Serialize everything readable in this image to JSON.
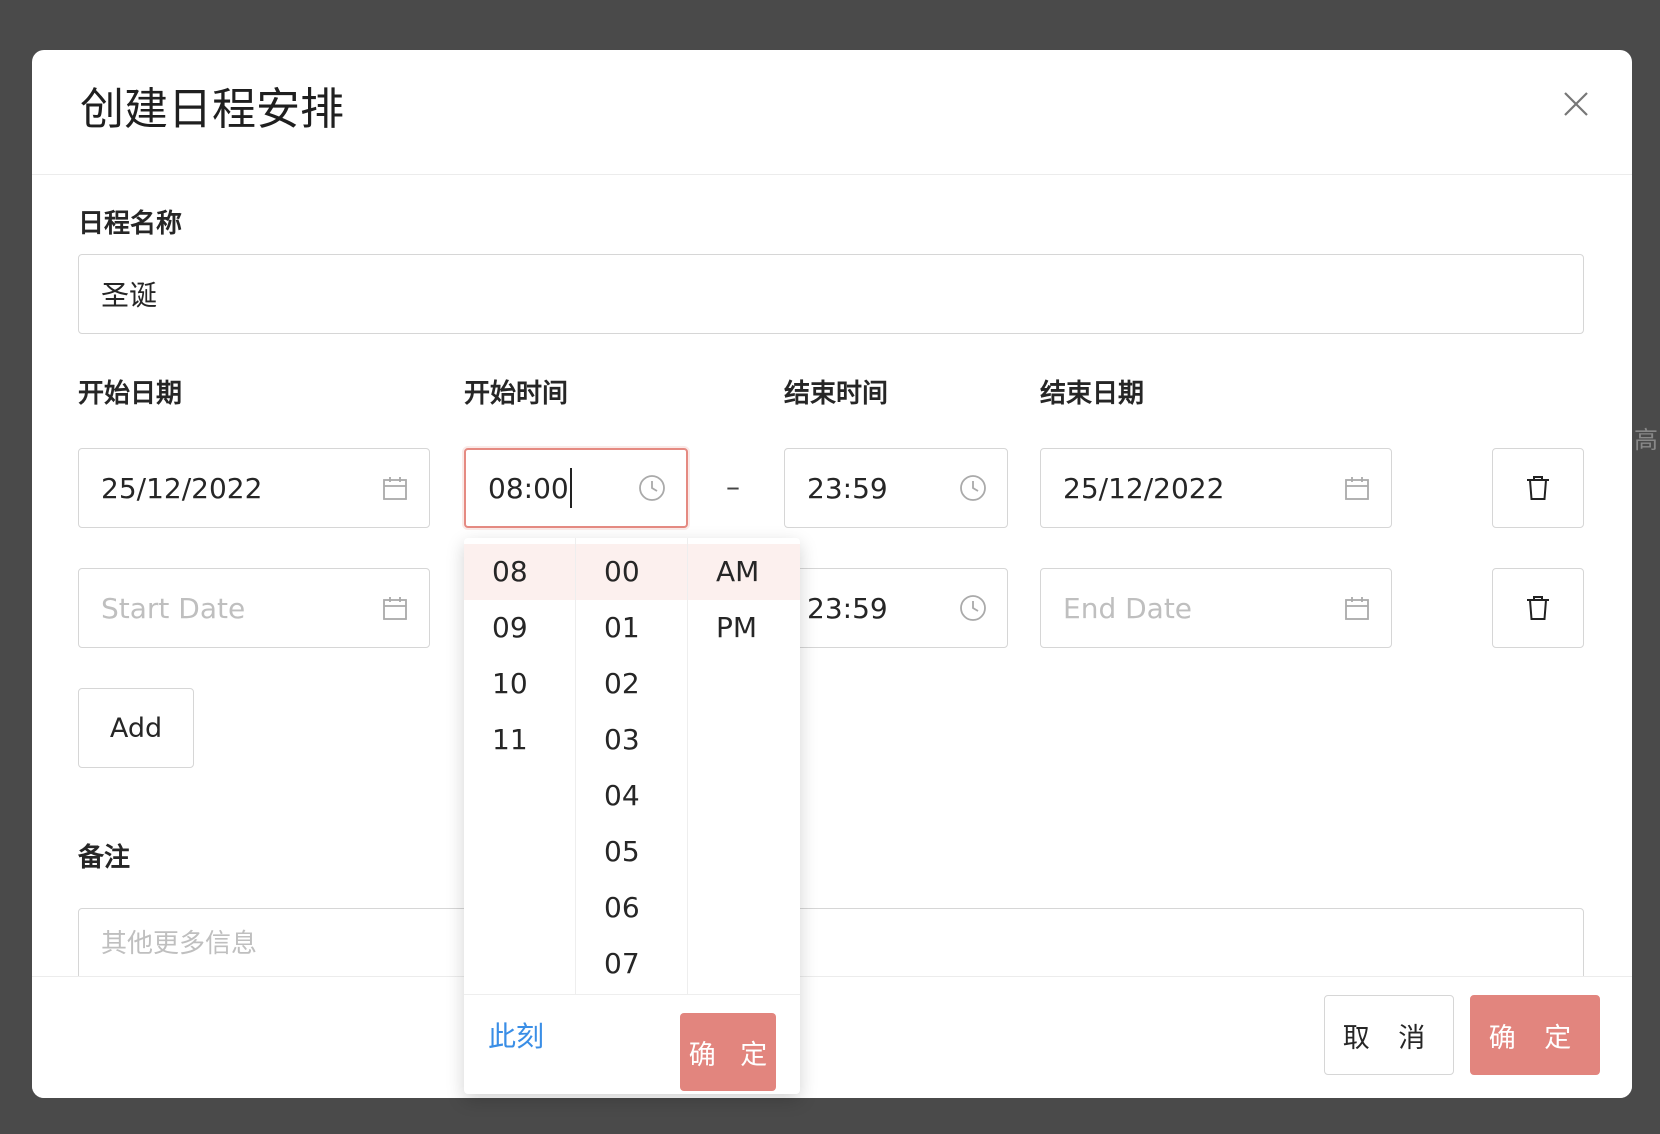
{
  "modal": {
    "title": "创建日程安排"
  },
  "schedule_name": {
    "label": "日程名称",
    "value": "圣诞"
  },
  "columns": {
    "start_date_label": "开始日期",
    "start_time_label": "开始时间",
    "end_time_label": "结束时间",
    "end_date_label": "结束日期"
  },
  "rows": [
    {
      "start_date": "25/12/2022",
      "start_time": "08:00",
      "separator": "–",
      "end_time": "23:59",
      "end_date": "25/12/2022"
    },
    {
      "start_date_placeholder": "Start Date",
      "end_time": "23:59",
      "end_date_placeholder": "End Date"
    }
  ],
  "add_button": "Add",
  "notes": {
    "label": "备注",
    "placeholder": "其他更多信息"
  },
  "footer": {
    "cancel": "取 消",
    "ok": "确 定"
  },
  "time_picker": {
    "hours": [
      "08",
      "09",
      "10",
      "11"
    ],
    "minutes": [
      "00",
      "01",
      "02",
      "03",
      "04",
      "05",
      "06",
      "07"
    ],
    "meridiem": [
      "AM",
      "PM"
    ],
    "selected_hour": "08",
    "selected_minute": "00",
    "selected_meridiem": "AM",
    "now_link": "此刻",
    "ok": "确 定"
  },
  "background_hint": "高",
  "colors": {
    "accent": "#e2857e",
    "link": "#3a8ee6",
    "backdrop": "#4a4a4a"
  }
}
